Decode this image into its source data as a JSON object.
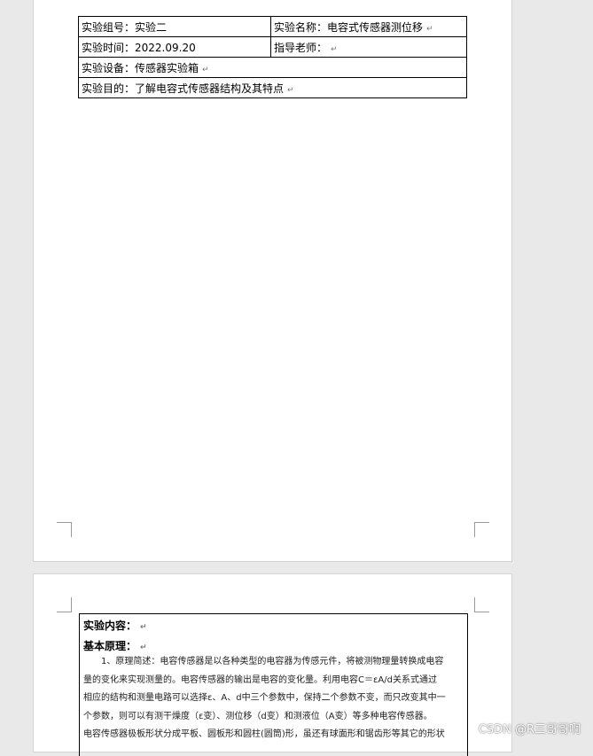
{
  "info_table": {
    "row1": {
      "left": "实验组号：实验二",
      "right": "实验名称：电容式传感器测位移"
    },
    "row2": {
      "left": "实验时间：2022.09.20",
      "right": "指导老师："
    },
    "row3": "实验设备：传感器实验箱",
    "row4": "实验目的：了解电容式传感器结构及其特点"
  },
  "para_mark": "↵",
  "page2": {
    "heading1": "实验内容：",
    "heading2": "基本原理：",
    "paragraph_lines": [
      "1、原理简述：电容传感器是以各种类型的电容器为传感元件，将被测物理量转换成电容",
      "量的变化来实现测量的。电容传感器的输出是电容的变化量。利用电容C＝εA/d关系式通过",
      "相应的结构和测量电路可以选择ε、A、d中三个参数中，保持二个参数不变，而只改变其中一",
      "个参数，则可以有测干燥度（ε变）、测位移（d变）和测液位（A变）等多种电容传感器。",
      "电容传感器极板形状分成平板、圆板形和圆柱(圆筒)形，虽还有球面形和锯齿形等其它的形状"
    ]
  },
  "watermark": "CSDN @R三哥哥啊"
}
